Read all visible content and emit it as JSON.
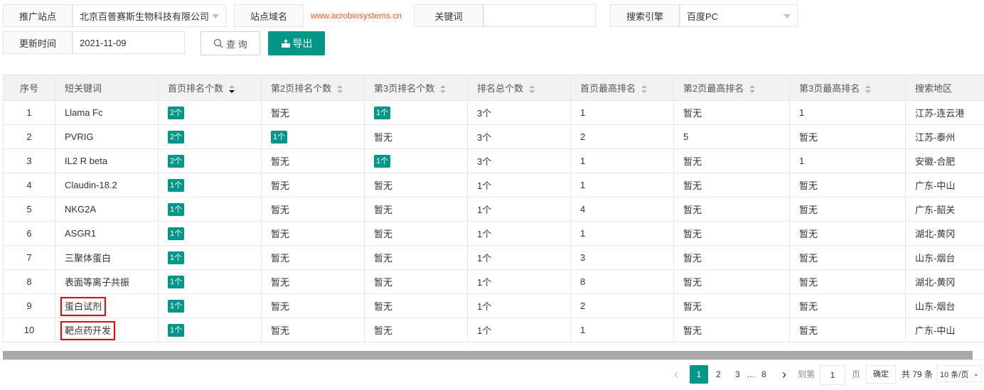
{
  "filters": {
    "site_label": "推广站点",
    "site_value": "北京百普赛斯生物科技有限公司",
    "domain_label": "站点域名",
    "domain_value": "www.acrobiosystems.cn",
    "keyword_label": "关键词",
    "keyword_value": "",
    "engine_label": "搜索引擎",
    "engine_value": "百度PC",
    "update_label": "更新时间",
    "update_value": "2021-11-09",
    "search_button": "查 询",
    "export_button": "导出"
  },
  "table": {
    "columns": [
      "序号",
      "短关键词",
      "首页排名个数",
      "第2页排名个数",
      "第3页排名个数",
      "排名总个数",
      "首页最高排名",
      "第2页最高排名",
      "第3页最高排名",
      "搜索地区"
    ],
    "rows": [
      [
        "1",
        "Llama Fc",
        "2个",
        "暂无",
        "1个",
        "3个",
        "1",
        "暂无",
        "1",
        "江苏-连云港"
      ],
      [
        "2",
        "PVRIG",
        "2个",
        "1个",
        "暂无",
        "3个",
        "2",
        "5",
        "暂无",
        "江苏-泰州"
      ],
      [
        "3",
        "IL2 R beta",
        "2个",
        "暂无",
        "1个",
        "3个",
        "1",
        "暂无",
        "1",
        "安徽-合肥"
      ],
      [
        "4",
        "Claudin-18.2",
        "1个",
        "暂无",
        "暂无",
        "1个",
        "1",
        "暂无",
        "暂无",
        "广东-中山"
      ],
      [
        "5",
        "NKG2A",
        "1个",
        "暂无",
        "暂无",
        "1个",
        "4",
        "暂无",
        "暂无",
        "广东-韶关"
      ],
      [
        "6",
        "ASGR1",
        "1个",
        "暂无",
        "暂无",
        "1个",
        "1",
        "暂无",
        "暂无",
        "湖北-黄冈"
      ],
      [
        "7",
        "三聚体蛋白",
        "1个",
        "暂无",
        "暂无",
        "1个",
        "3",
        "暂无",
        "暂无",
        "山东-烟台"
      ],
      [
        "8",
        "表面等离子共振",
        "1个",
        "暂无",
        "暂无",
        "1个",
        "8",
        "暂无",
        "暂无",
        "湖北-黄冈"
      ],
      [
        "9",
        "蛋白试剂",
        "1个",
        "暂无",
        "暂无",
        "1个",
        "2",
        "暂无",
        "暂无",
        "山东-烟台"
      ],
      [
        "10",
        "靶点药开发",
        "1个",
        "暂无",
        "暂无",
        "1个",
        "1",
        "暂无",
        "暂无",
        "广东-中山"
      ]
    ]
  },
  "pagination": {
    "prev": "‹",
    "pages": [
      "1",
      "2",
      "3"
    ],
    "ellipsis": "…",
    "last_page": "8",
    "next": "›",
    "goto_label": "到第",
    "goto_value": "1",
    "page_unit": "页",
    "confirm": "确定",
    "total": "共 79 条",
    "page_size": "10 条/页"
  },
  "colors": {
    "accent": "#009688",
    "highlight": "#ff0000",
    "domain_text": "#ff5722"
  }
}
